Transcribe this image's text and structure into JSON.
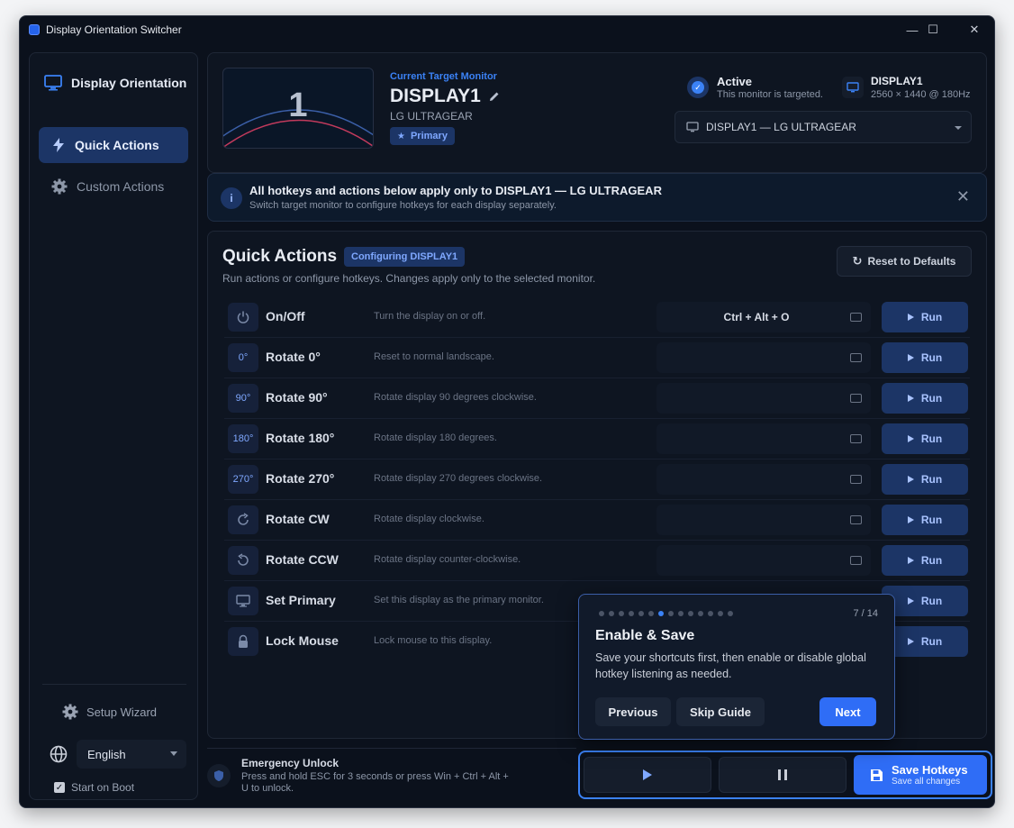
{
  "window": {
    "title": "Display Orientation Switcher",
    "controls": {
      "minimize": "—",
      "maximize": "☐",
      "close": "✕"
    }
  },
  "sidebar": {
    "brand": "Display Orientation",
    "items": [
      {
        "label": "Quick Actions",
        "icon": "lightning-icon",
        "active": true
      },
      {
        "label": "Custom Actions",
        "icon": "gear-icon",
        "active": false
      }
    ],
    "setup_wizard": "Setup Wizard",
    "language": "English",
    "start_on_boot": "Start on Boot"
  },
  "monitor": {
    "thumb_number": "1",
    "target_label": "Current Target Monitor",
    "name": "DISPLAY1",
    "model": "LG ULTRAGEAR",
    "primary_badge": "Primary",
    "status_title": "Active",
    "status_sub": "This monitor is targeted.",
    "display_id": "DISPLAY1",
    "resolution": "2560 × 1440 @ 180Hz",
    "selector": "DISPLAY1 — LG ULTRAGEAR"
  },
  "banner": {
    "title": "All hotkeys and actions below apply only to DISPLAY1 — LG ULTRAGEAR",
    "subtitle": "Switch target monitor to configure hotkeys for each display separately.",
    "close": "✕"
  },
  "quick_actions": {
    "title": "Quick Actions",
    "configuring": "Configuring DISPLAY1",
    "subtitle": "Run actions or configure hotkeys. Changes apply only to the selected monitor.",
    "reset": "Reset to Defaults",
    "run_label": "Run",
    "rows": [
      {
        "icon": "power-icon",
        "icon_text": "",
        "name": "On/Off",
        "desc": "Turn the display on or off.",
        "hotkey": "Ctrl + Alt + O"
      },
      {
        "icon": "rotate-0-icon",
        "icon_text": "0°",
        "name": "Rotate 0°",
        "desc": "Reset to normal landscape.",
        "hotkey": ""
      },
      {
        "icon": "rotate-90-icon",
        "icon_text": "90°",
        "name": "Rotate 90°",
        "desc": "Rotate display 90 degrees clockwise.",
        "hotkey": ""
      },
      {
        "icon": "rotate-180-icon",
        "icon_text": "180°",
        "name": "Rotate 180°",
        "desc": "Rotate display 180 degrees.",
        "hotkey": ""
      },
      {
        "icon": "rotate-270-icon",
        "icon_text": "270°",
        "name": "Rotate 270°",
        "desc": "Rotate display 270 degrees clockwise.",
        "hotkey": ""
      },
      {
        "icon": "rotate-cw-icon",
        "icon_text": "",
        "name": "Rotate CW",
        "desc": "Rotate display clockwise.",
        "hotkey": ""
      },
      {
        "icon": "rotate-ccw-icon",
        "icon_text": "",
        "name": "Rotate CCW",
        "desc": "Rotate display counter-clockwise.",
        "hotkey": ""
      },
      {
        "icon": "monitor-icon",
        "icon_text": "",
        "name": "Set Primary",
        "desc": "Set this display as the primary monitor.",
        "hotkey": ""
      },
      {
        "icon": "lock-icon",
        "icon_text": "",
        "name": "Lock Mouse",
        "desc": "Lock mouse to this display.",
        "hotkey": ""
      }
    ]
  },
  "emergency": {
    "title": "Emergency Unlock",
    "subtitle": "Press and hold ESC for 3 seconds or press Win + Ctrl + Alt + U to unlock."
  },
  "controls": {
    "save_title": "Save Hotkeys",
    "save_sub": "Save all changes"
  },
  "guide": {
    "step": "7 / 14",
    "current": 7,
    "total": 14,
    "title": "Enable & Save",
    "body": "Save your shortcuts first, then enable or disable global hotkey listening as needed.",
    "previous": "Previous",
    "skip": "Skip Guide",
    "next": "Next"
  },
  "colors": {
    "accent": "#3b82f6",
    "button_primary": "#2f6df6",
    "background": "#0b111c"
  }
}
